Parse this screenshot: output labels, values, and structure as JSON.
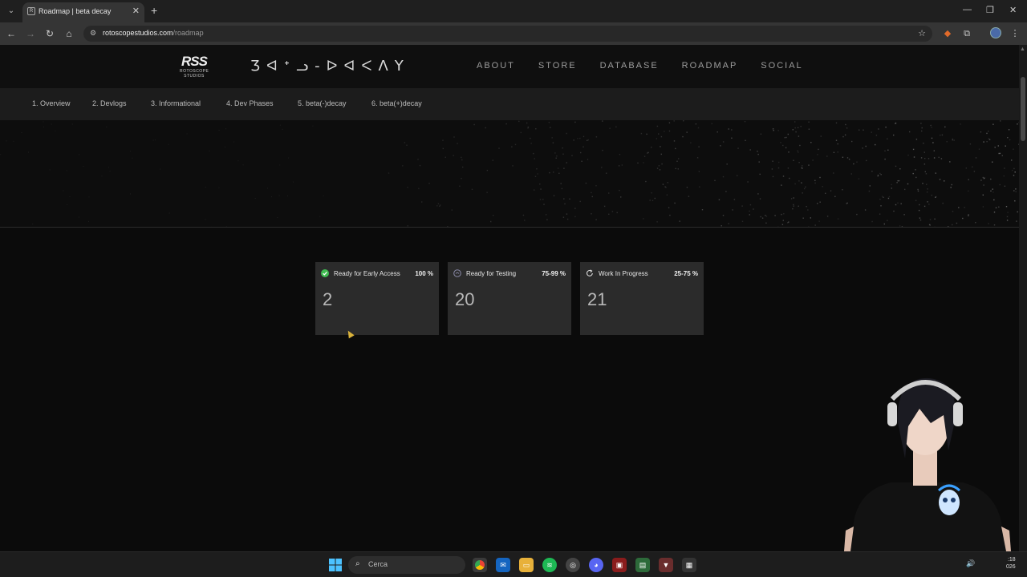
{
  "browser": {
    "tab_title": "Roadmap | beta decay",
    "url_host": "rotoscopestudios.com",
    "url_path": "/roadmap"
  },
  "site": {
    "logo_text": "RSS",
    "logo_subtext": "ROTOSCOPE STUDIOS",
    "glyph_title": "Ʒᐊᐩᓗ-ᐅᐊᐸᐱY",
    "nav": [
      "ABOUT",
      "STORE",
      "DATABASE",
      "ROADMAP",
      "SOCIAL"
    ]
  },
  "subnav": [
    "1. Overview",
    "2. Devlogs",
    "3. Informational",
    "4. Dev Phases",
    "5. beta(-)decay",
    "6. beta(+)decay"
  ],
  "cards": [
    {
      "label": "Ready for Early Access",
      "percent": "100 %",
      "count": "2",
      "icon": "check-circle-icon",
      "icon_color": "#3fb950"
    },
    {
      "label": "Ready for Testing",
      "percent": "75-99 %",
      "count": "20",
      "icon": "testing-icon",
      "icon_color": "#8a8aa8"
    },
    {
      "label": "Work In Progress",
      "percent": "25-75 %",
      "count": "21",
      "icon": "refresh-icon",
      "icon_color": "#dddddd"
    }
  ],
  "taskbar": {
    "search_text": "Cerca",
    "clock_time": ":18",
    "clock_date": "026"
  }
}
